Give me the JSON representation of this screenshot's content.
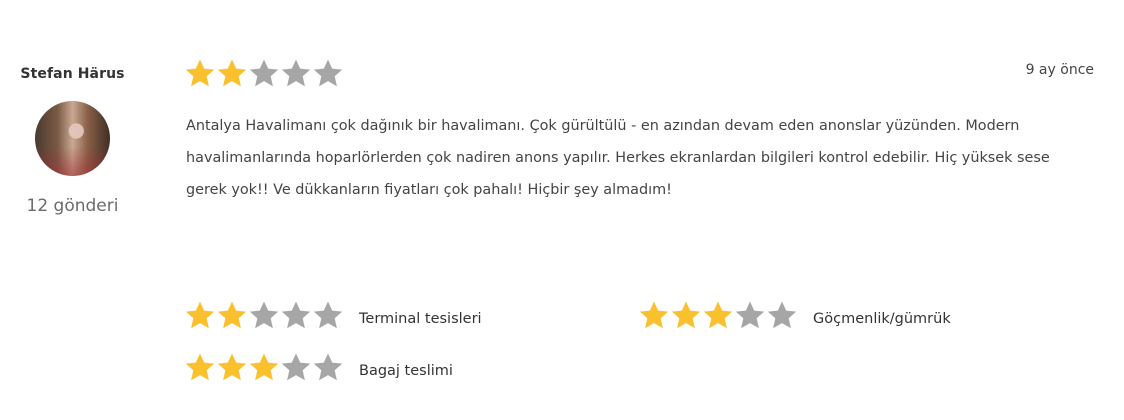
{
  "author": {
    "name": "Stefan Härus",
    "posts": "12 gönderi"
  },
  "review": {
    "rating": 2,
    "max_rating": 5,
    "date": "9 ay önce",
    "text": "Antalya Havalimanı çok dağınık bir havalimanı. Çok gürültülü - en azından devam eden anonslar yüzünden. Modern havalimanlarında hoparlörlerden çok nadiren anons yapılır. Herkes ekranlardan bilgileri kontrol edebilir. Hiç yüksek sese gerek yok!! Ve dükkanların fiyatları çok pahalı! Hiçbir şey almadım!"
  },
  "sub_ratings": [
    {
      "label": "Terminal tesisleri",
      "rating": 2
    },
    {
      "label": "Göçmenlik/gümrük",
      "rating": 3
    },
    {
      "label": "Bagaj teslimi",
      "rating": 3
    }
  ],
  "colors": {
    "star_filled": "#FBC02D",
    "star_empty": "#A6A6A6",
    "text": "#444444",
    "muted": "#6b6b6b"
  },
  "icons": {
    "star": "star-icon",
    "avatar": "user-avatar"
  }
}
